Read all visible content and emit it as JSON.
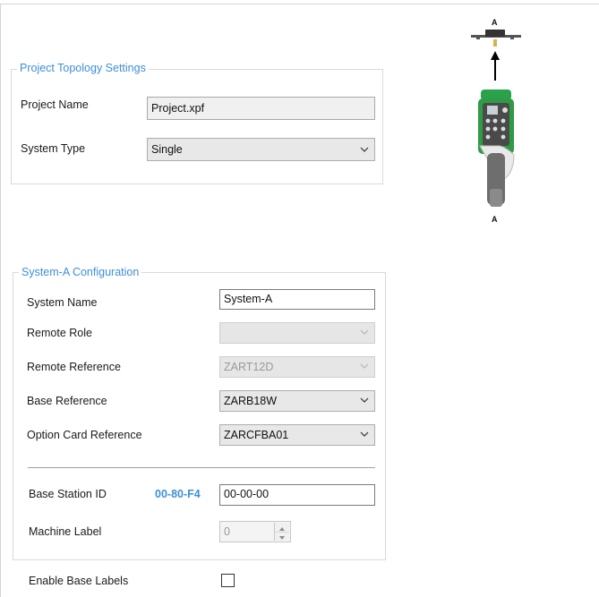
{
  "topology": {
    "legend": "Project Topology Settings",
    "project_name_label": "Project Name",
    "project_name_value": "Project.xpf",
    "system_type_label": "System Type",
    "system_type_value": "Single"
  },
  "diagram": {
    "top_label": "A",
    "bottom_label": "A",
    "colors": {
      "accent_green": "#29a24b",
      "body_gray": "#6e6e6e"
    }
  },
  "system_a": {
    "legend": "System-A Configuration",
    "system_name_label": "System Name",
    "system_name_value": "System-A",
    "remote_role_label": "Remote Role",
    "remote_role_value": "",
    "remote_reference_label": "Remote Reference",
    "remote_reference_value": "ZART12D",
    "base_reference_label": "Base Reference",
    "base_reference_value": "ZARB18W",
    "option_card_label": "Option Card Reference",
    "option_card_value": "ZARCFBA01",
    "base_station_id_label": "Base Station ID",
    "base_station_prefix": "00-80-F4",
    "base_station_id_value": "00-00-00",
    "machine_label_label": "Machine Label",
    "machine_label_value": "0"
  },
  "enable_base_labels": {
    "label": "Enable Base Labels",
    "checked": false
  },
  "colors": {
    "legend_blue": "#3f8fd8"
  }
}
